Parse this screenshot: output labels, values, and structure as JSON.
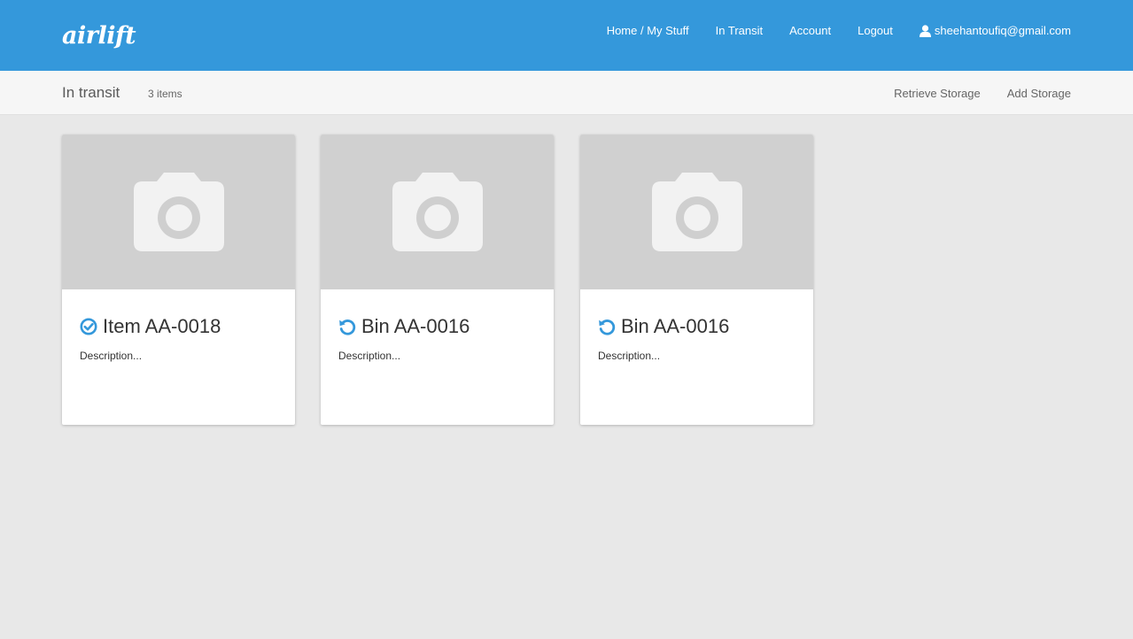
{
  "header": {
    "logo": "airlift",
    "nav": [
      {
        "label": "Home / My Stuff"
      },
      {
        "label": "In Transit"
      },
      {
        "label": "Account"
      },
      {
        "label": "Logout"
      }
    ],
    "user_email": "sheehantoufiq@gmail.com"
  },
  "subheader": {
    "title": "In transit",
    "count": "3 items",
    "actions": [
      {
        "label": "Retrieve Storage"
      },
      {
        "label": "Add Storage"
      }
    ]
  },
  "cards": [
    {
      "title": "Item AA-0018",
      "description": "Description...",
      "status_icon": "check-circle-icon"
    },
    {
      "title": "Bin AA-0016",
      "description": "Description...",
      "status_icon": "refresh-icon"
    },
    {
      "title": "Bin AA-0016",
      "description": "Description...",
      "status_icon": "refresh-icon"
    }
  ],
  "colors": {
    "header_bg": "#3498db",
    "accent": "#3498db",
    "page_bg": "#e8e8e8",
    "photo_placeholder": "#d0d0d0"
  }
}
